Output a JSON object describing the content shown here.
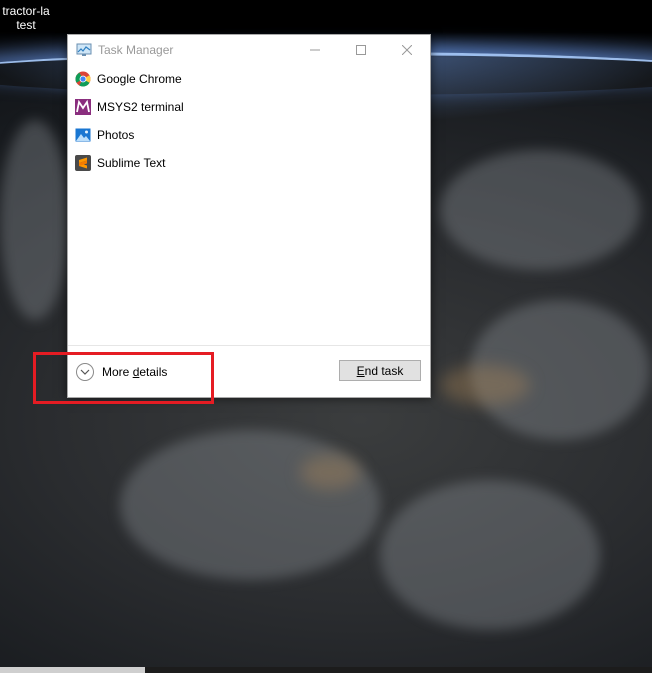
{
  "desktop": {
    "icon_label_line1": "tractor-la",
    "icon_label_line2": "test"
  },
  "window": {
    "title": "Task Manager",
    "minimize_label": "—",
    "maximize_label": "☐",
    "close_label": "✕"
  },
  "processes": [
    {
      "name": "Google Chrome",
      "icon": "chrome-icon"
    },
    {
      "name": "MSYS2 terminal",
      "icon": "msys2-icon"
    },
    {
      "name": "Photos",
      "icon": "photos-icon"
    },
    {
      "name": "Sublime Text",
      "icon": "sublime-text-icon"
    }
  ],
  "footer": {
    "more_details_pre": "More ",
    "more_details_accel": "d",
    "more_details_post": "etails",
    "end_task_accel": "E",
    "end_task_post": "nd task"
  },
  "colors": {
    "highlight": "#e51c23",
    "button_bg": "#e1e1e1",
    "title_text": "#999999"
  }
}
